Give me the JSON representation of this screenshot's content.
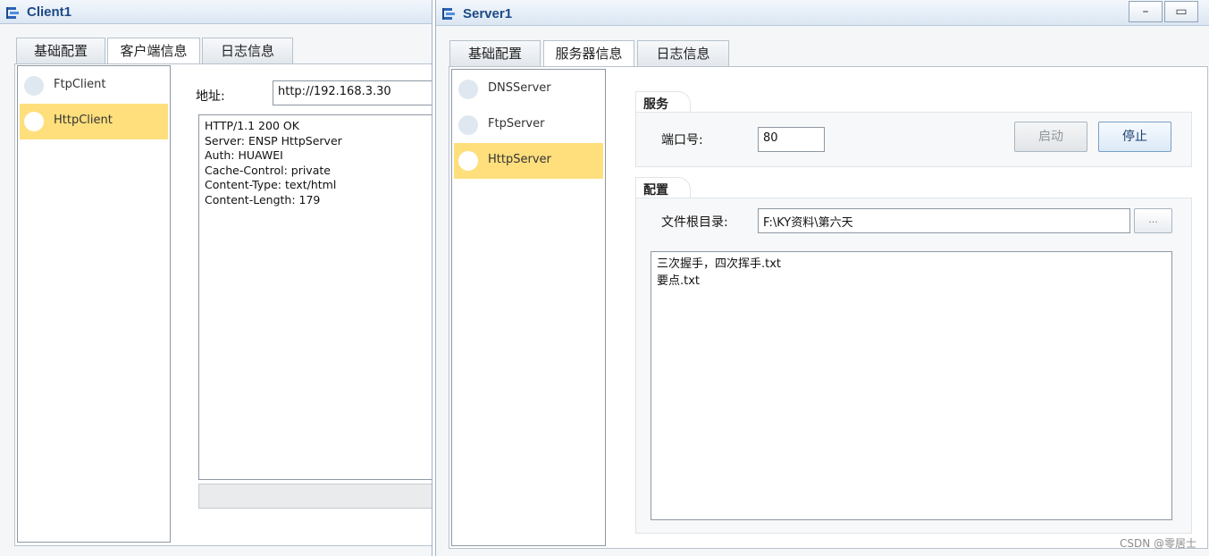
{
  "client": {
    "title": "Client1",
    "tabs": [
      "基础配置",
      "客户端信息",
      "日志信息"
    ],
    "list_items": [
      "FtpClient",
      "HttpClient"
    ],
    "selected_item": "HttpClient",
    "address_label": "地址:",
    "address_value": "http://192.168.3.30",
    "response_lines": [
      "HTTP/1.1 200 OK",
      "Server: ENSP HttpServer",
      "Auth: HUAWEI",
      "Cache-Control: private",
      "Content-Type: text/html",
      "Content-Length: 179"
    ]
  },
  "server": {
    "title": "Server1",
    "window_controls": [
      "–",
      "▭"
    ],
    "tabs": [
      "基础配置",
      "服务器信息",
      "日志信息"
    ],
    "list_items": [
      "DNSServer",
      "FtpServer",
      "HttpServer"
    ],
    "selected_item": "HttpServer",
    "service_group": {
      "title": "服务",
      "port_label": "端口号:",
      "port_value": "80",
      "start_label": "启动",
      "stop_label": "停止"
    },
    "config_group": {
      "title": "配置",
      "root_dir_label": "文件根目录:",
      "root_dir_value": "F:\\KY资料\\第六天",
      "browse_label": "...",
      "files": [
        "三次握手，四次挥手.txt",
        "要点.txt"
      ]
    }
  },
  "watermark": "CSDN @零居士",
  "colors": {
    "selected_row": "#fedf7c",
    "title_text": "#1c4a85"
  }
}
